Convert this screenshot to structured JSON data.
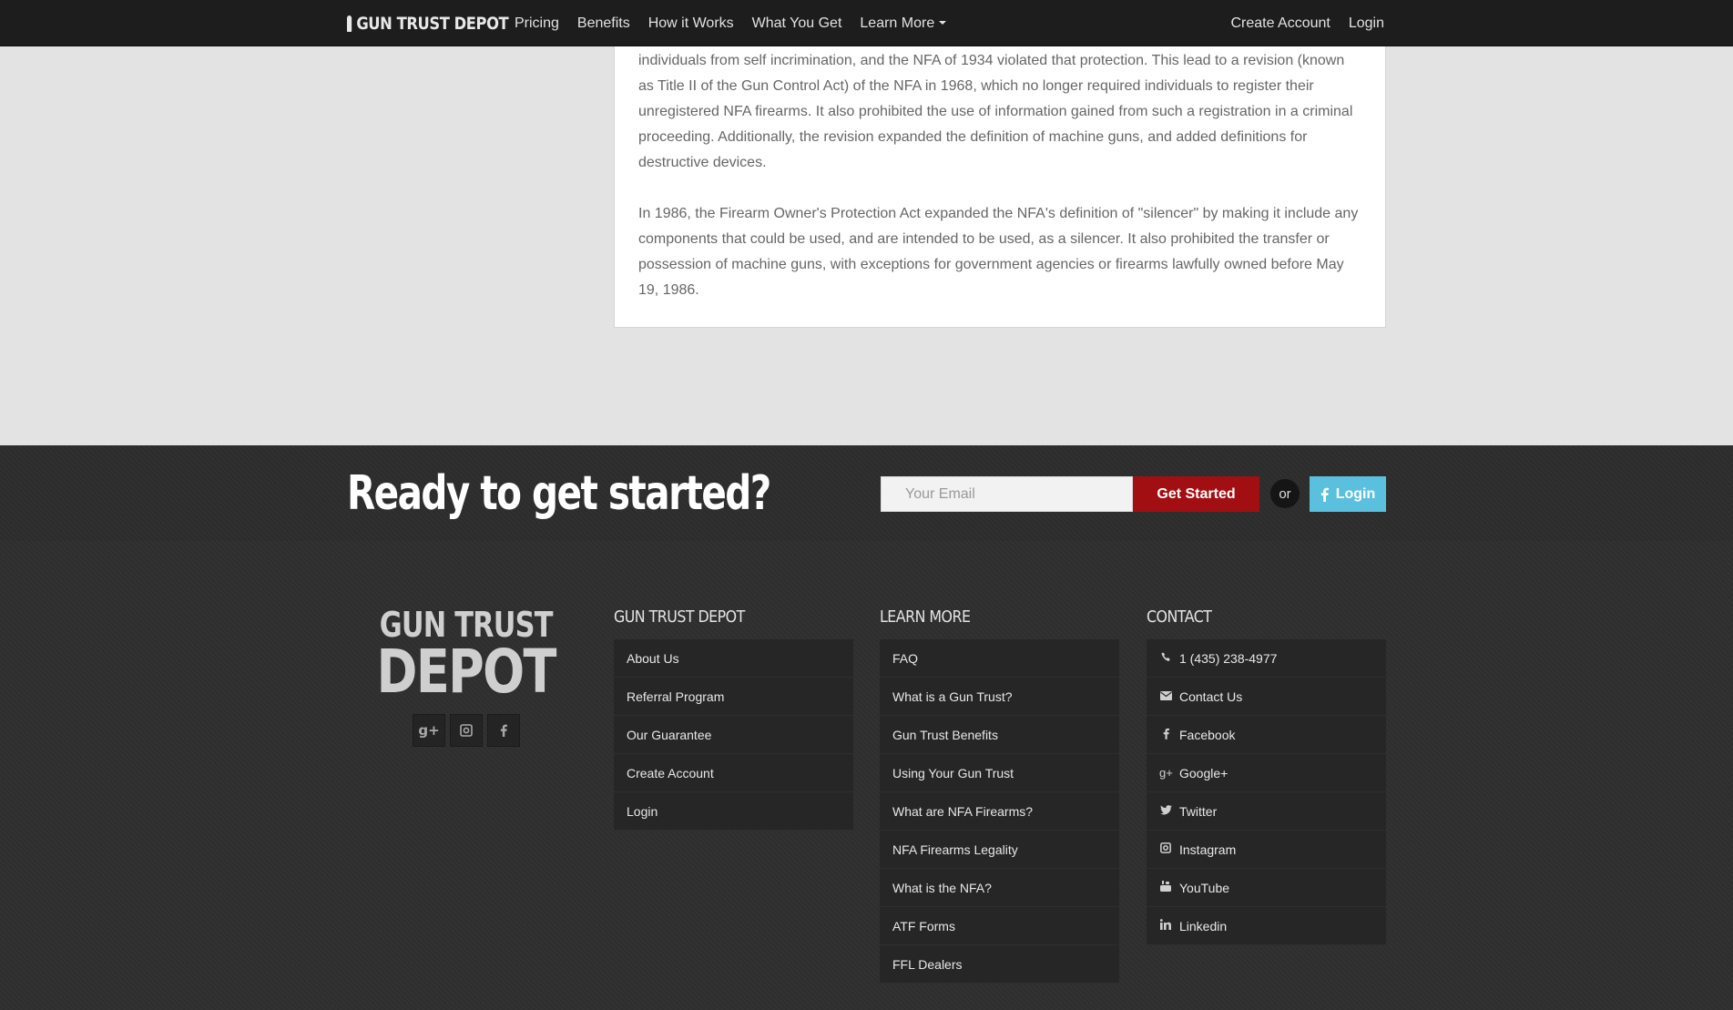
{
  "nav": {
    "brand": "GUN TRUST DEPOT",
    "links": [
      "Pricing",
      "Benefits",
      "How it Works",
      "What You Get",
      "Learn More"
    ],
    "create_account": "Create Account",
    "login": "Login"
  },
  "article": {
    "paragraphs": [
      "individuals from self incrimination, and the NFA of 1934 violated that protection. This lead to a revision (known as Title II of the Gun Control Act) of the NFA in 1968, which no longer required individuals to register their unregistered NFA firearms. It also prohibited the use of information gained from such a registration in a criminal proceeding. Additionally, the revision expanded the definition of machine guns, and added definitions for destructive devices.",
      "In 1986, the Firearm Owner's Protection Act expanded the NFA's definition of \"silencer\" by making it include any components that could be used, and are intended to be used, as a silencer. It also prohibited the transfer or possession of machine guns, with exceptions for government agencies or firearms lawfully owned before May 19, 1986."
    ]
  },
  "cta": {
    "title": "Ready to get started?",
    "email_placeholder": "Your Email",
    "get_started": "Get Started",
    "or": "or",
    "fb_login": "Login"
  },
  "footer": {
    "logo_line1": "GUN TRUST",
    "logo_line2": "DEPOT",
    "col1": {
      "heading": "GUN TRUST DEPOT",
      "items": [
        "About Us",
        "Referral Program",
        "Our Guarantee",
        "Create Account",
        "Login"
      ]
    },
    "col2": {
      "heading": "LEARN MORE",
      "items": [
        "FAQ",
        "What is a Gun Trust?",
        "Gun Trust Benefits",
        "Using Your Gun Trust",
        "What are NFA Firearms?",
        "NFA Firearms Legality",
        "What is the NFA?",
        "ATF Forms",
        "FFL Dealers"
      ]
    },
    "col3": {
      "heading": "CONTACT",
      "items": [
        "1 (435) 238-4977",
        "Contact Us",
        "Facebook",
        "Google+",
        "Twitter",
        "Instagram",
        "YouTube",
        "Linkedin"
      ],
      "icons": [
        "phone-icon",
        "envelope-icon",
        "facebook-icon",
        "google-plus-icon",
        "twitter-icon",
        "instagram-icon",
        "youtube-icon",
        "linkedin-icon"
      ]
    }
  },
  "colors": {
    "nav_bg": "#1d1d1d",
    "page_bg": "#e3e3e3",
    "cta_red": "#a20f13",
    "fb_blue": "#5bc0de",
    "footer_bg": "#2e2e2e"
  }
}
